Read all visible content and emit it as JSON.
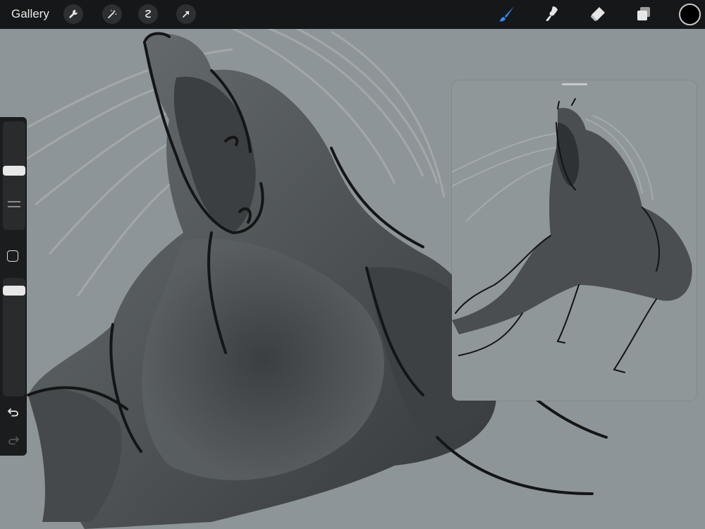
{
  "app": {
    "gallery_label": "Gallery"
  },
  "toolbar": {
    "left_tools": [
      "wrench-icon",
      "magic-wand-icon",
      "selection-icon",
      "transform-arrow-icon"
    ],
    "right_tools": [
      "brush-icon",
      "smudge-icon",
      "eraser-icon",
      "layers-icon"
    ],
    "active_tool": "brush-icon",
    "accent_color": "#2f8dff",
    "current_color": "#000000"
  },
  "sidebar": {
    "brush_size_level": 0.55,
    "opacity_level": 0.93,
    "undo_icon": "undo-icon",
    "redo_icon": "redo-icon"
  },
  "reference": {
    "visible": true
  }
}
